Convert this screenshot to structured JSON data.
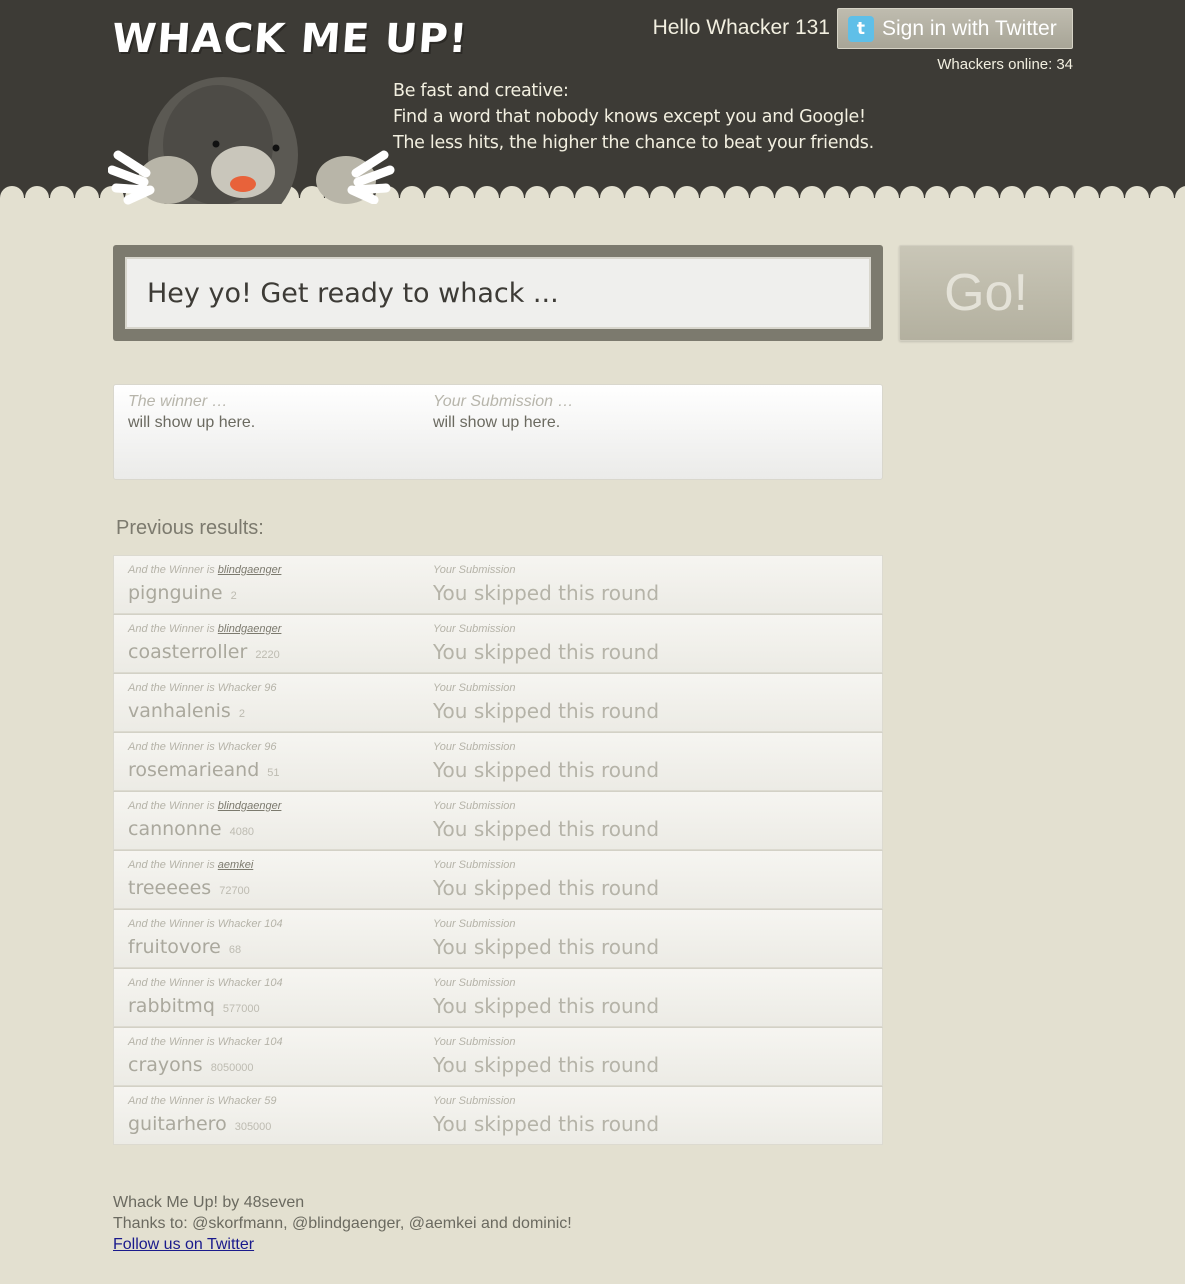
{
  "header": {
    "logo": "WHACK ME UP!",
    "tagline": [
      "Be fast and creative:",
      "Find a word that nobody knows except you and Google!",
      "The less hits, the higher the chance to beat your friends."
    ],
    "hello": "Hello Whacker 131",
    "twitter_button": "Sign in with Twitter",
    "online_label": "Whackers online:",
    "online_count": "34",
    "colors": {
      "background": "#3d3b36",
      "content_bg": "#e3e0d0"
    }
  },
  "input": {
    "placeholder": "Hey yo! Get ready to whack ...",
    "go_label": "Go!"
  },
  "current": {
    "winner_label": "The winner …",
    "winner_value": "will show up here.",
    "submission_label": "Your Submission …",
    "submission_value": "will show up here."
  },
  "previous": {
    "title": "Previous results:",
    "rows": [
      {
        "label": "And the Winner is",
        "winner": "blindgaenger",
        "linked": true,
        "word": "pignguine",
        "hits": "2",
        "sub_label": "Your Submission",
        "sub_value": "You skipped this round"
      },
      {
        "label": "And the Winner is",
        "winner": "blindgaenger",
        "linked": true,
        "word": "coasterroller",
        "hits": "2220",
        "sub_label": "Your Submission",
        "sub_value": "You skipped this round"
      },
      {
        "label": "And the Winner is",
        "winner": "Whacker 96",
        "linked": false,
        "word": "vanhalenis",
        "hits": "2",
        "sub_label": "Your Submission",
        "sub_value": "You skipped this round"
      },
      {
        "label": "And the Winner is",
        "winner": "Whacker 96",
        "linked": false,
        "word": "rosemarieand",
        "hits": "51",
        "sub_label": "Your Submission",
        "sub_value": "You skipped this round"
      },
      {
        "label": "And the Winner is",
        "winner": "blindgaenger",
        "linked": true,
        "word": "cannonne",
        "hits": "4080",
        "sub_label": "Your Submission",
        "sub_value": "You skipped this round"
      },
      {
        "label": "And the Winner is",
        "winner": "aemkei",
        "linked": true,
        "word": "treeeees",
        "hits": "72700",
        "sub_label": "Your Submission",
        "sub_value": "You skipped this round"
      },
      {
        "label": "And the Winner is",
        "winner": "Whacker 104",
        "linked": false,
        "word": "fruitovore",
        "hits": "68",
        "sub_label": "Your Submission",
        "sub_value": "You skipped this round"
      },
      {
        "label": "And the Winner is",
        "winner": "Whacker 104",
        "linked": false,
        "word": "rabbitmq",
        "hits": "577000",
        "sub_label": "Your Submission",
        "sub_value": "You skipped this round"
      },
      {
        "label": "And the Winner is",
        "winner": "Whacker 104",
        "linked": false,
        "word": "crayons",
        "hits": "8050000",
        "sub_label": "Your Submission",
        "sub_value": "You skipped this round"
      },
      {
        "label": "And the Winner is",
        "winner": "Whacker 59",
        "linked": false,
        "word": "guitarhero",
        "hits": "305000",
        "sub_label": "Your Submission",
        "sub_value": "You skipped this round"
      }
    ]
  },
  "footer": {
    "credit": "Whack Me Up! by 48seven",
    "thanks": "Thanks to: @skorfmann, @blindgaenger, @aemkei and dominic!",
    "follow_link": "Follow us on Twitter"
  }
}
